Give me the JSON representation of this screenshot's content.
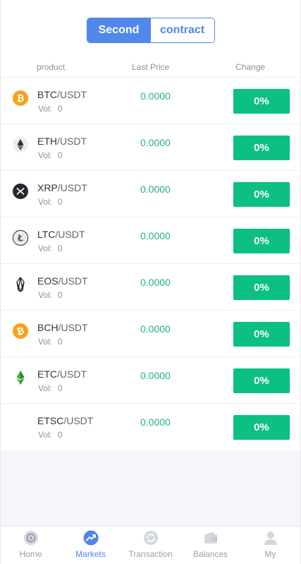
{
  "segment": {
    "tabs": [
      {
        "label": "Second",
        "active": true
      },
      {
        "label": "contract",
        "active": false
      }
    ]
  },
  "table_header": {
    "product": "product",
    "last_price": "Last Price",
    "change": "Change"
  },
  "vol_label": "Vol:",
  "markets": [
    {
      "base": "BTC",
      "quote": "/USDT",
      "vol": "0",
      "price": "0.0000",
      "change": "0%",
      "icon": "bitcoin-icon"
    },
    {
      "base": "ETH",
      "quote": "/USDT",
      "vol": "0",
      "price": "0.0000",
      "change": "0%",
      "icon": "ethereum-icon"
    },
    {
      "base": "XRP",
      "quote": "/USDT",
      "vol": "0",
      "price": "0.0000",
      "change": "0%",
      "icon": "xrp-icon"
    },
    {
      "base": "LTC",
      "quote": "/USDT",
      "vol": "0",
      "price": "0.0000",
      "change": "0%",
      "icon": "litecoin-icon"
    },
    {
      "base": "EOS",
      "quote": "/USDT",
      "vol": "0",
      "price": "0.0000",
      "change": "0%",
      "icon": "eos-icon"
    },
    {
      "base": "BCH",
      "quote": "/USDT",
      "vol": "0",
      "price": "0.0000",
      "change": "0%",
      "icon": "bitcoin-cash-icon"
    },
    {
      "base": "ETC",
      "quote": "/USDT",
      "vol": "0",
      "price": "0.0000",
      "change": "0%",
      "icon": "ethereum-classic-icon"
    },
    {
      "base": "ETSC",
      "quote": "/USDT",
      "vol": "0",
      "price": "0.0000",
      "change": "0%",
      "icon": "none"
    }
  ],
  "tabbar": [
    {
      "label": "Home",
      "icon": "home-icon",
      "active": false
    },
    {
      "label": "Markets",
      "icon": "markets-icon",
      "active": true
    },
    {
      "label": "Transaction",
      "icon": "transaction-icon",
      "active": false
    },
    {
      "label": "Balances",
      "icon": "wallet-icon",
      "active": false
    },
    {
      "label": "My",
      "icon": "user-icon",
      "active": false
    }
  ],
  "colors": {
    "accent": "#4f86e8",
    "positive": "#0cbf84",
    "price_text": "#20b27c",
    "bitcoin": "#f7a11a"
  }
}
